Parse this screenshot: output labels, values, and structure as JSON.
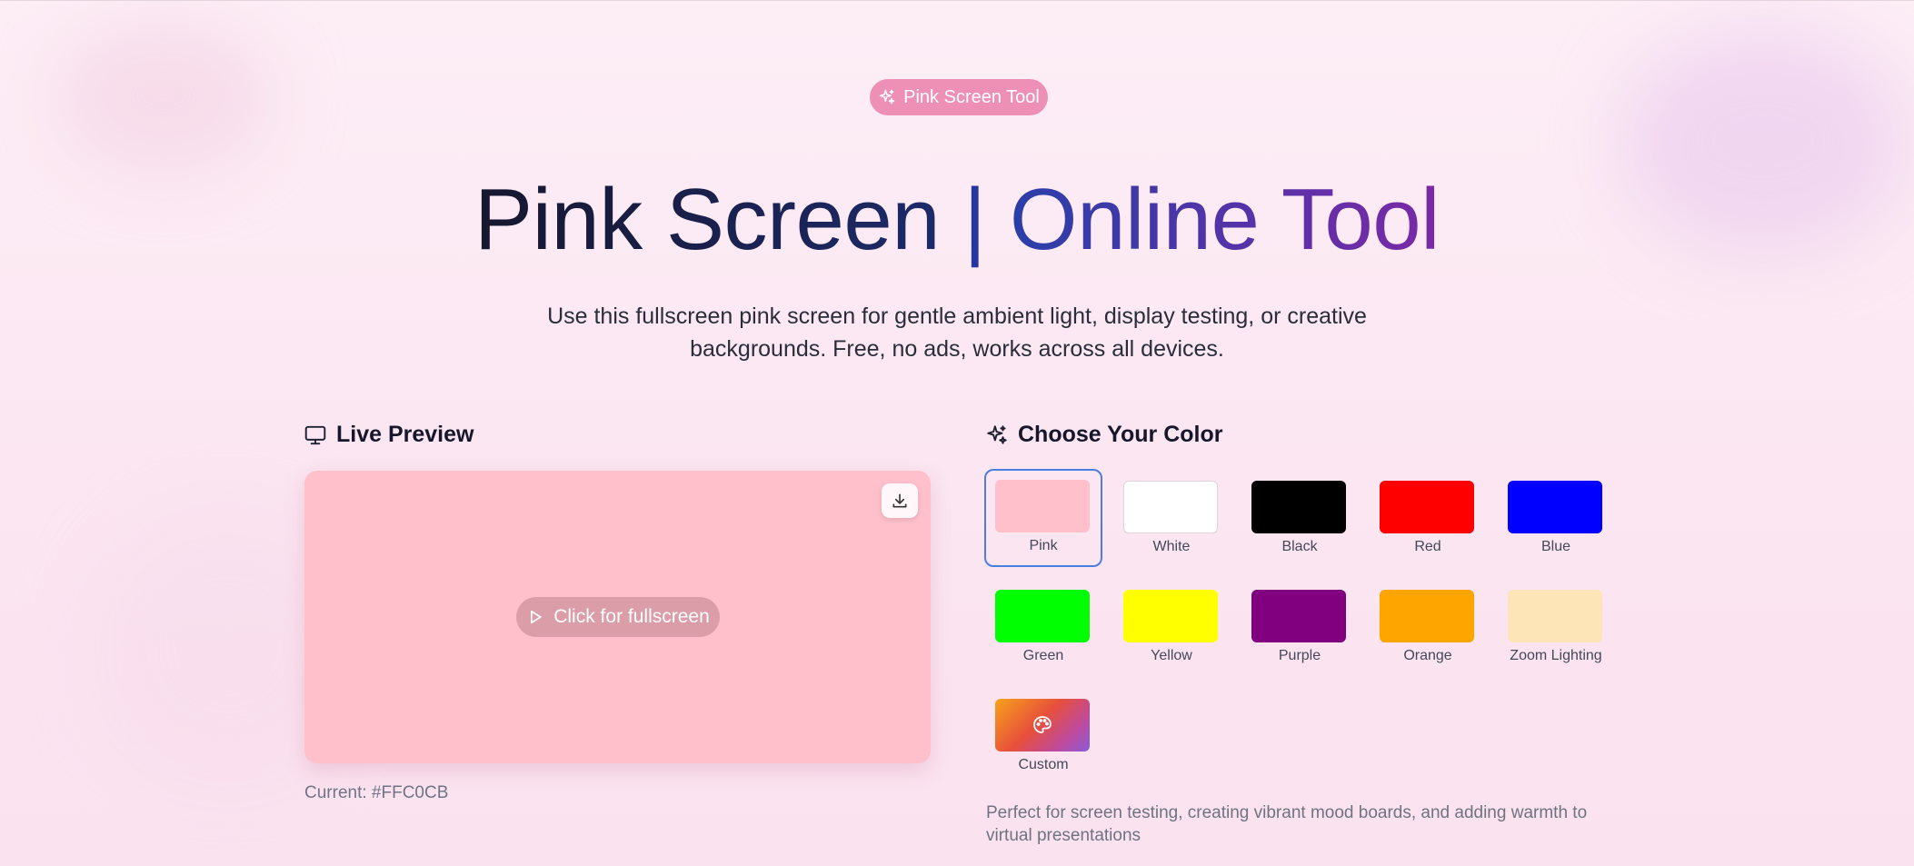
{
  "badge": {
    "label": "Pink Screen Tool",
    "icon": "sparkles-icon"
  },
  "hero": {
    "title_part1": "Pink Screen",
    "title_separator": "|",
    "title_part2": "Online Tool",
    "subtitle": "Use this fullscreen pink screen for gentle ambient light, display testing, or creative backgrounds. Free, no ads, works across all devices."
  },
  "preview": {
    "heading": "Live Preview",
    "heading_icon": "monitor-icon",
    "color": "#FFC0CB",
    "download_icon": "download-icon",
    "fullscreen_label": "Click for fullscreen",
    "fullscreen_icon": "play-icon",
    "current_label": "Current: #FFC0CB"
  },
  "colors": {
    "heading": "Choose Your Color",
    "heading_icon": "sparkles-icon",
    "selected": "Pink",
    "swatches": [
      {
        "label": "Pink",
        "color": "#FFC0CB"
      },
      {
        "label": "White",
        "color": "#FFFFFF"
      },
      {
        "label": "Black",
        "color": "#000000"
      },
      {
        "label": "Red",
        "color": "#FF0000"
      },
      {
        "label": "Blue",
        "color": "#0000FF"
      },
      {
        "label": "Green",
        "color": "#00FF00"
      },
      {
        "label": "Yellow",
        "color": "#FFFF00"
      },
      {
        "label": "Purple",
        "color": "#800080"
      },
      {
        "label": "Orange",
        "color": "#FFA500"
      },
      {
        "label": "Zoom Lighting",
        "color": "#FDE5B8"
      },
      {
        "label": "Custom",
        "color": "gradient",
        "icon": "palette-icon"
      }
    ],
    "note": "Perfect for screen testing, creating vibrant mood boards, and adding warmth to virtual presentations"
  }
}
